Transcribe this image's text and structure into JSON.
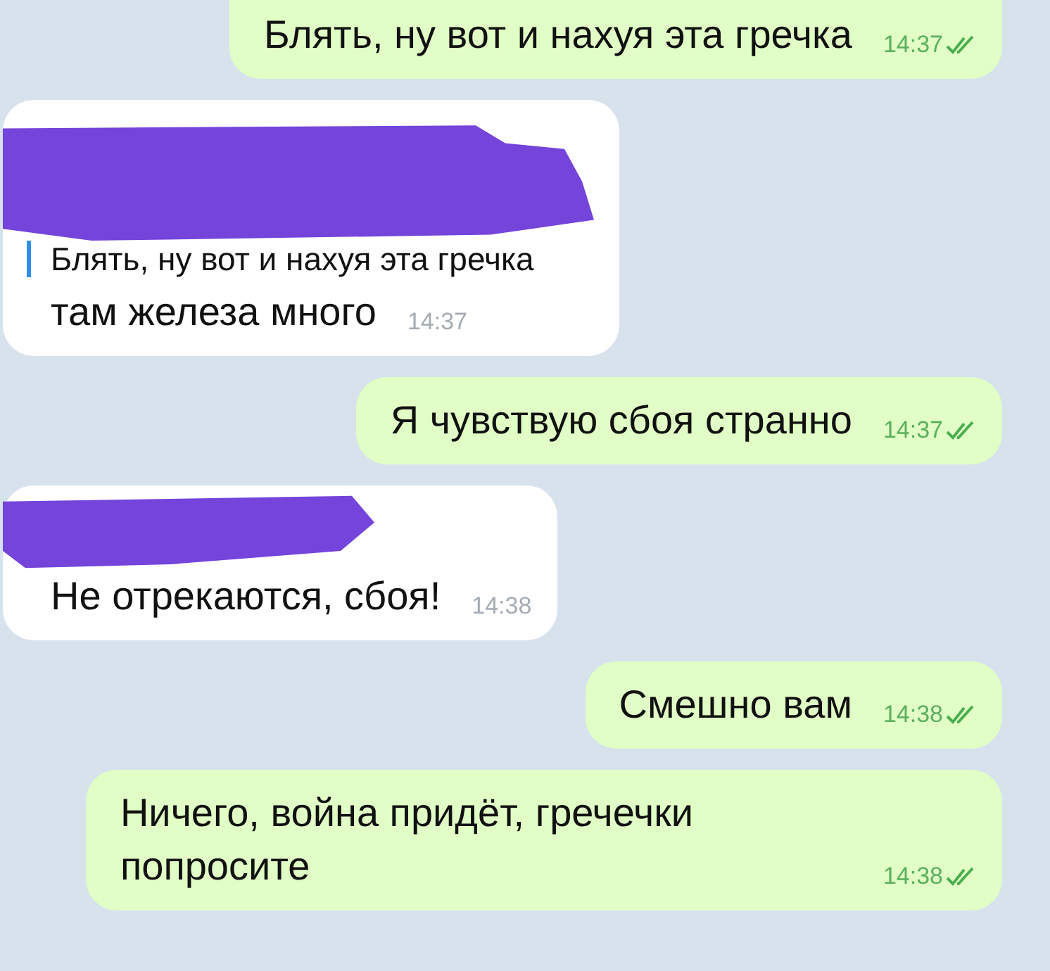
{
  "messages": [
    {
      "kind": "outgoing",
      "text": "Блять, ну вот и нахуя эта гречка",
      "time": "14:37",
      "read": true
    },
    {
      "kind": "incoming",
      "redacted": true,
      "reply": {
        "text": "Блять, ну вот и нахуя эта гречка"
      },
      "text": "там железа много",
      "time": "14:37"
    },
    {
      "kind": "outgoing",
      "text": "Я чувствую сбоя странно",
      "time": "14:37",
      "read": true
    },
    {
      "kind": "incoming",
      "redacted": true,
      "text": "Не отрекаются, сбоя!",
      "time": "14:38"
    },
    {
      "kind": "outgoing",
      "text": "Смешно вам",
      "time": "14:38",
      "read": true
    },
    {
      "kind": "outgoing",
      "text": "Ничего, война придёт, гречечки попросите",
      "time": "14:38",
      "read": true
    }
  ]
}
